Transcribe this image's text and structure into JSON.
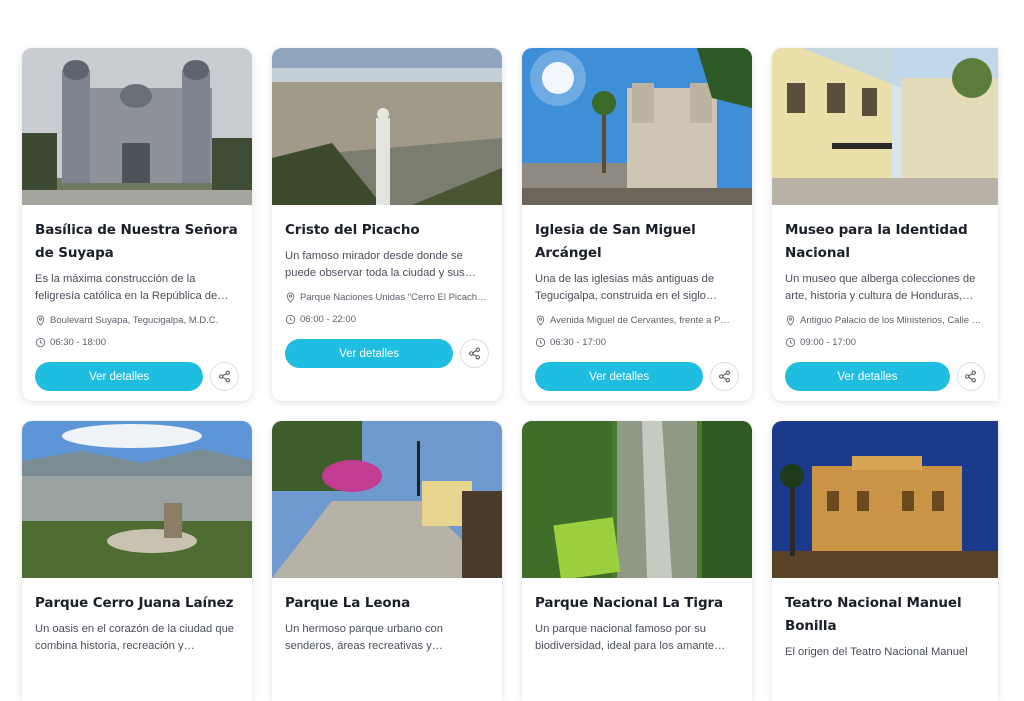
{
  "cards": [
    {
      "title": "Basílica de Nuestra Señora de Suyapa",
      "description": "Es la máxima construcción de la feligresía católica en la República de…",
      "location": "Boulevard Suyapa, Tegucigalpa, M.D.C.",
      "hours": "06:30 - 18:00",
      "button": "Ver detalles",
      "icons": {
        "location": "map-pin-icon",
        "hours": "clock-icon",
        "share": "share-icon"
      }
    },
    {
      "title": "Cristo del Picacho",
      "description": "Un famoso mirador desde donde se puede observar toda la ciudad y sus…",
      "location": "Parque Naciones Unidas \"Cerro El Picach…",
      "hours": "06:00 - 22:00",
      "button": "Ver detalles",
      "icons": {
        "location": "map-pin-icon",
        "hours": "clock-icon",
        "share": "share-icon"
      }
    },
    {
      "title": "Iglesia de San Miguel Arcángel",
      "description": "Una de las iglesias más antiguas de Tegucigalpa, construida en el siglo…",
      "location": "Avenida Miguel de Cervantes, frente a P…",
      "hours": "06:30 - 17:00",
      "button": "Ver detalles",
      "icons": {
        "location": "map-pin-icon",
        "hours": "clock-icon",
        "share": "share-icon"
      }
    },
    {
      "title": "Museo para la Identidad Nacional",
      "description": "Un museo que alberga colecciones de arte, historia y cultura de Honduras,…",
      "location": "Antiguo Palacio de los Ministerios, Calle …",
      "hours": "09:00 - 17:00",
      "button": "Ver detalles",
      "icons": {
        "location": "map-pin-icon",
        "hours": "clock-icon",
        "share": "share-icon"
      }
    },
    {
      "title": "Parque Cerro Juana Laínez",
      "description": "Un oasis en el corazón de la ciudad que combina historia, recreación y…"
    },
    {
      "title": "Parque La Leona",
      "description": "Un hermoso parque urbano con senderos, áreas recreativas y…"
    },
    {
      "title": "Parque Nacional La Tigra",
      "description": "Un parque nacional famoso por su biodiversidad, ideal para los amante…"
    },
    {
      "title": "Teatro Nacional Manuel Bonilla",
      "description": "El origen del Teatro Nacional Manuel"
    }
  ],
  "colors": {
    "accent": "#1fbde0",
    "title": "#1b1f2a",
    "text": "#4a4f5a"
  }
}
